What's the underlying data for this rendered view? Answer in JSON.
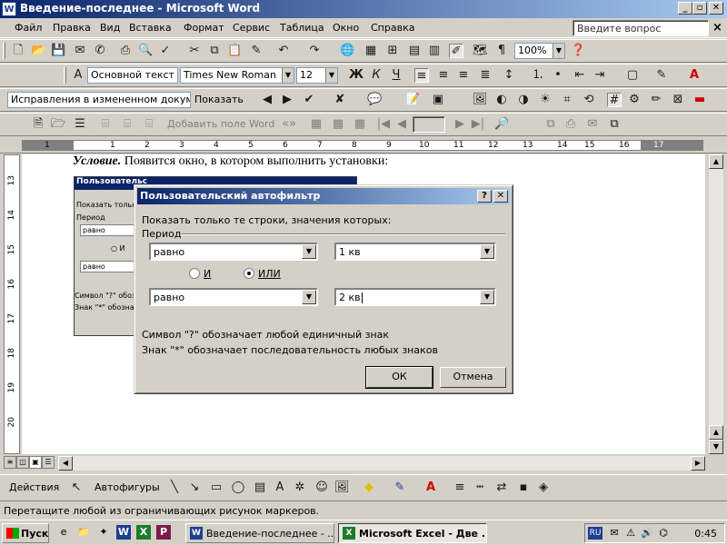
{
  "window": {
    "title": "Введение-последнее - Microsoft Word",
    "app_icon": "W"
  },
  "menu": {
    "items": [
      "Файл",
      "Правка",
      "Вид",
      "Вставка",
      "Формат",
      "Сервис",
      "Таблица",
      "Окно",
      "Справка"
    ],
    "help_placeholder": "Введите вопрос"
  },
  "standard_toolbar": {
    "zoom": "100%"
  },
  "formatting_toolbar": {
    "style": "Основной текст",
    "font": "Times New Roman",
    "size": "12"
  },
  "review_toolbar": {
    "mode": "Исправления в измененном документ",
    "show_label": "Показать"
  },
  "mail_toolbar": {
    "add_field_label": "Добавить поле Word"
  },
  "ruler": {
    "marks": [
      "1",
      "1",
      "2",
      "3",
      "4",
      "5",
      "6",
      "7",
      "8",
      "9",
      "10",
      "11",
      "12",
      "13",
      "14",
      "15",
      "16",
      "17"
    ]
  },
  "vruler": {
    "marks": [
      "13",
      "14",
      "15",
      "16",
      "17",
      "18",
      "19",
      "20"
    ]
  },
  "document": {
    "bold_text": "Условие.",
    "text": " Появится окно, в котором выполнить установки:"
  },
  "embedded": {
    "title": "Пользовательс",
    "line1": "Показать только",
    "line2": "Период",
    "combo1": "равно",
    "radio": "И",
    "combo2": "равно",
    "note1": "Символ \"?\" обозн",
    "note2": "Знак \"*\" обознач"
  },
  "dialog": {
    "title": "Пользовательский автофильтр",
    "help_btn": "?",
    "close_btn": "✕",
    "instruction": "Показать только те строки, значения которых:",
    "field": "Период",
    "op1": "равно",
    "val1": "1 кв",
    "radio_and": "И",
    "radio_or": "ИЛИ",
    "op2": "равно",
    "val2": "2 кв",
    "hint1": "Символ \"?\" обозначает любой единичный знак",
    "hint2": "Знак \"*\" обозначает последовательность любых знаков",
    "ok": "ОК",
    "cancel": "Отмена"
  },
  "drawing_toolbar": {
    "actions": "Действия",
    "autoshapes": "Автофигуры"
  },
  "status": {
    "text": "Перетащите любой из ограничивающих рисунок маркеров."
  },
  "taskbar": {
    "start": "Пуск",
    "tasks": [
      "Введение-последнее - ...",
      "Microsoft Excel - Две ..."
    ],
    "lang": "RU",
    "clock": "0:45"
  }
}
